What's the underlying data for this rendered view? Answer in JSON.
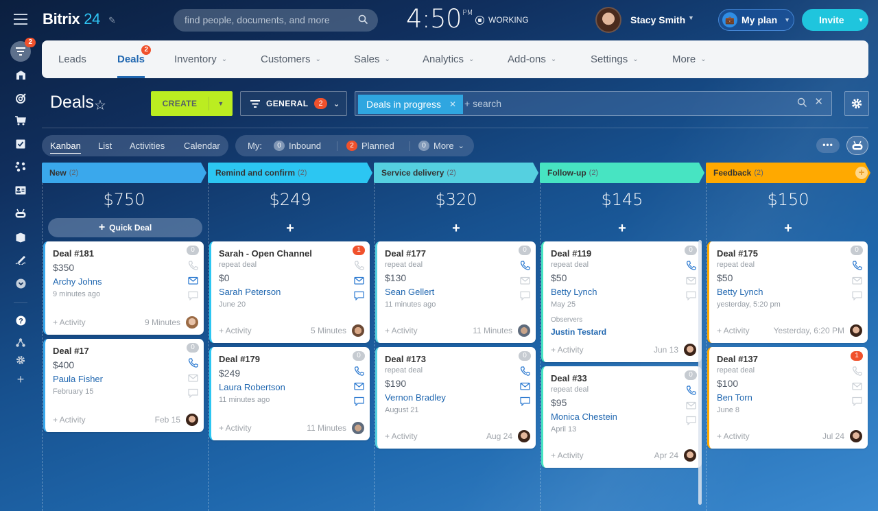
{
  "app": {
    "logo_text": "Bitrix",
    "logo_num": "24",
    "search_placeholder": "find people, documents, and more",
    "clock": "4:50",
    "clock_ampm": "PM",
    "status": "WORKING",
    "user_name": "Stacy Smith",
    "plan_label": "My plan",
    "invite_label": "Invite"
  },
  "rail": {
    "badge": "2",
    "items": [
      "crm-funnel",
      "inventory-store",
      "target",
      "cart",
      "tasks",
      "sites",
      "contact-card",
      "robot",
      "box",
      "signature",
      "more"
    ],
    "bottom_items": [
      "help",
      "sitemap",
      "settings",
      "add"
    ]
  },
  "nav": {
    "tabs": [
      {
        "label": "Leads"
      },
      {
        "label": "Deals",
        "badge": "2",
        "active": true
      },
      {
        "label": "Inventory"
      },
      {
        "label": "Customers"
      },
      {
        "label": "Sales"
      },
      {
        "label": "Analytics"
      },
      {
        "label": "Add-ons"
      },
      {
        "label": "Settings"
      },
      {
        "label": "More"
      }
    ]
  },
  "page": {
    "title": "Deals",
    "create_label": "CREATE",
    "general_label": "GENERAL",
    "general_badge": "2",
    "filter_chip": "Deals in progress",
    "filter_search": "+ search"
  },
  "views": {
    "items": [
      "Kanban",
      "List",
      "Activities",
      "Calendar"
    ],
    "active": "Kanban"
  },
  "counters": {
    "label": "My:",
    "items": [
      {
        "count": "0",
        "label": "Inbound"
      },
      {
        "count": "2",
        "label": "Planned"
      },
      {
        "count": "0",
        "label": "More"
      }
    ]
  },
  "colors": {
    "new": "#3aa8ec",
    "remind": "#2cc6f2",
    "service": "#55d0e0",
    "followup": "#47e4c2",
    "feedback": "#ffa900",
    "accent": "#2067b0",
    "create": "#bbed21"
  },
  "columns": [
    {
      "name": "New",
      "count": "(2)",
      "sum": "$750",
      "add_label": "Quick Deal",
      "cards": [
        {
          "title": "Deal #181",
          "amount": "$350",
          "client": "Archy Johns",
          "date": "9 minutes ago",
          "badge": "0",
          "activity": "+ Activity",
          "time": "9 Minutes"
        },
        {
          "title": "Deal #17",
          "amount": "$400",
          "client": "Paula Fisher",
          "date": "February 15",
          "badge": "0",
          "activity": "+ Activity",
          "time": "Feb 15"
        }
      ]
    },
    {
      "name": "Remind and confirm",
      "count": "(2)",
      "sum": "$249",
      "cards": [
        {
          "title": "Sarah - Open Channel",
          "sub": "repeat deal",
          "amount": "$0",
          "client": "Sarah Peterson",
          "date": "June 20",
          "badge": "1",
          "activity": "+ Activity",
          "time": "5 Minutes"
        },
        {
          "title": "Deal #179",
          "amount": "$249",
          "client": "Laura Robertson",
          "date": "11 minutes ago",
          "badge": "0",
          "activity": "+ Activity",
          "time": "11 Minutes"
        }
      ]
    },
    {
      "name": "Service delivery",
      "count": "(2)",
      "sum": "$320",
      "cards": [
        {
          "title": "Deal #177",
          "sub": "repeat deal",
          "amount": "$130",
          "client": "Sean Gellert",
          "date": "11 minutes ago",
          "badge": "0",
          "activity": "+ Activity",
          "time": "11 Minutes"
        },
        {
          "title": "Deal #173",
          "sub": "repeat deal",
          "amount": "$190",
          "client": "Vernon Bradley",
          "date": "August 21",
          "badge": "0",
          "activity": "+ Activity",
          "time": "Aug 24"
        }
      ]
    },
    {
      "name": "Follow-up",
      "count": "(2)",
      "sum": "$145",
      "cards": [
        {
          "title": "Deal #119",
          "sub": "repeat deal",
          "amount": "$50",
          "client": "Betty Lynch",
          "date": "May 25",
          "observers_label": "Observers",
          "observer": "Justin Testard",
          "badge": "0",
          "activity": "+ Activity",
          "time": "Jun 13"
        },
        {
          "title": "Deal #33",
          "sub": "repeat deal",
          "amount": "$95",
          "client": "Monica Chestein",
          "date": "April 13",
          "badge": "0",
          "activity": "+ Activity",
          "time": "Apr 24"
        }
      ]
    },
    {
      "name": "Feedback",
      "count": "(2)",
      "sum": "$150",
      "cards": [
        {
          "title": "Deal #175",
          "sub": "repeat deal",
          "amount": "$50",
          "client": "Betty Lynch",
          "date": "yesterday, 5:20 pm",
          "badge": "0",
          "activity": "+ Activity",
          "time": "Yesterday, 6:20 PM"
        },
        {
          "title": "Deal #137",
          "sub": "repeat deal",
          "amount": "$100",
          "client": "Ben Torn",
          "date": "June 8",
          "badge": "1",
          "activity": "+ Activity",
          "time": "Jul 24"
        }
      ]
    }
  ]
}
